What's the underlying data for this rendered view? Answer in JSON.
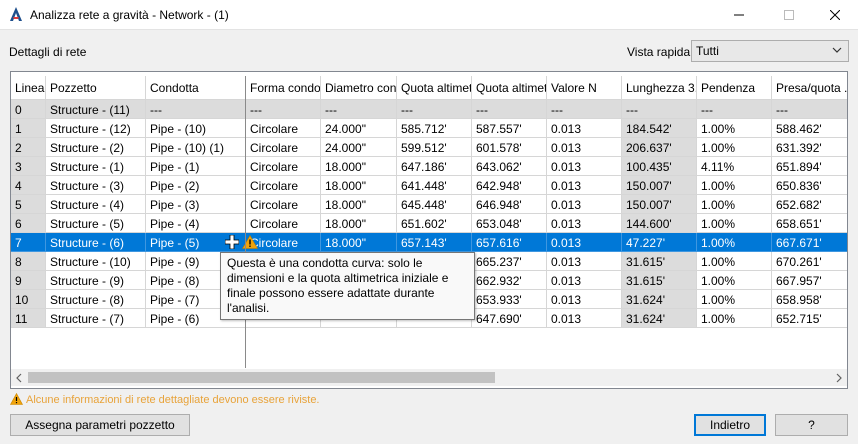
{
  "window": {
    "title": "Analizza rete a gravità - Network - (1)",
    "buttons": [
      "minimize",
      "maximize",
      "close"
    ]
  },
  "section_label": "Dettagli di rete",
  "quick_view": {
    "label": "Vista rapida",
    "value": "Tutti"
  },
  "table": {
    "columns": [
      "Linea",
      "Pozzetto",
      "Condotta",
      "Forma condo",
      "Diametro con...",
      "Quota altimet...",
      "Quota altimet...",
      "Valore N",
      "Lunghezza 3...",
      "Pendenza",
      "Presa/quota ..."
    ],
    "rows": [
      [
        "0",
        "Structure - (11)",
        "---",
        "---",
        "---",
        "---",
        "---",
        "---",
        "---",
        "---",
        "---"
      ],
      [
        "1",
        "Structure - (12)",
        "Pipe - (10)",
        "Circolare",
        "24.000\"",
        "585.712'",
        "587.557'",
        "0.013",
        "184.542'",
        "1.00%",
        "588.462'"
      ],
      [
        "2",
        "Structure - (2)",
        "Pipe - (10) (1)",
        "Circolare",
        "24.000\"",
        "599.512'",
        "601.578'",
        "0.013",
        "206.637'",
        "1.00%",
        "631.392'"
      ],
      [
        "3",
        "Structure - (1)",
        "Pipe - (1)",
        "Circolare",
        "18.000\"",
        "647.186'",
        "643.062'",
        "0.013",
        "100.435'",
        "4.11%",
        "651.894'"
      ],
      [
        "4",
        "Structure - (3)",
        "Pipe - (2)",
        "Circolare",
        "18.000\"",
        "641.448'",
        "642.948'",
        "0.013",
        "150.007'",
        "1.00%",
        "650.836'"
      ],
      [
        "5",
        "Structure - (4)",
        "Pipe - (3)",
        "Circolare",
        "18.000\"",
        "645.448'",
        "646.948'",
        "0.013",
        "150.007'",
        "1.00%",
        "652.682'"
      ],
      [
        "6",
        "Structure - (5)",
        "Pipe - (4)",
        "Circolare",
        "18.000\"",
        "651.602'",
        "653.048'",
        "0.013",
        "144.600'",
        "1.00%",
        "658.651'"
      ],
      [
        "7",
        "Structure - (6)",
        "Pipe - (5)",
        "Circolare",
        "18.000\"",
        "657.143'",
        "657.616'",
        "0.013",
        "47.227'",
        "1.00%",
        "667.671'"
      ],
      [
        "8",
        "Structure - (10)",
        "Pipe - (9)",
        "",
        "",
        "",
        "665.237'",
        "0.013",
        "31.615'",
        "1.00%",
        "670.261'"
      ],
      [
        "9",
        "Structure - (9)",
        "Pipe - (8)",
        "",
        "",
        "",
        "662.932'",
        "0.013",
        "31.615'",
        "1.00%",
        "667.957'"
      ],
      [
        "10",
        "Structure - (8)",
        "Pipe - (7)",
        "",
        "",
        "",
        "653.933'",
        "0.013",
        "31.624'",
        "1.00%",
        "658.958'"
      ],
      [
        "11",
        "Structure - (7)",
        "Pipe - (6)",
        "",
        "",
        "",
        "647.690'",
        "0.013",
        "31.624'",
        "1.00%",
        "652.715'"
      ]
    ],
    "selected_row": 7
  },
  "tooltip": "Questa è una condotta curva: solo le dimensioni e la quota altimetrica iniziale e finale possono essere adattate durante l'analisi.",
  "warning": "Alcune informazioni di rete dettagliate devono essere riviste.",
  "buttons": {
    "assign": "Assegna parametri pozzetto",
    "back": "Indietro",
    "help": "?"
  },
  "colors": {
    "selection": "#0078d7",
    "warning": "#e8a33a",
    "gray_cell": "#dcdcdc"
  }
}
